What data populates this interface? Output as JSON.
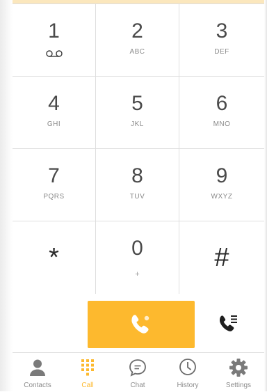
{
  "keypad": {
    "keys": [
      {
        "digit": "1",
        "letters": ""
      },
      {
        "digit": "2",
        "letters": "ABC"
      },
      {
        "digit": "3",
        "letters": "DEF"
      },
      {
        "digit": "4",
        "letters": "GHI"
      },
      {
        "digit": "5",
        "letters": "JKL"
      },
      {
        "digit": "6",
        "letters": "MNO"
      },
      {
        "digit": "7",
        "letters": "PQRS"
      },
      {
        "digit": "8",
        "letters": "TUV"
      },
      {
        "digit": "9",
        "letters": "WXYZ"
      },
      {
        "digit": "*",
        "letters": ""
      },
      {
        "digit": "0",
        "letters": "+"
      },
      {
        "digit": "#",
        "letters": ""
      }
    ]
  },
  "tabs": [
    {
      "label": "Contacts",
      "icon": "person-icon"
    },
    {
      "label": "Call",
      "icon": "dialpad-icon",
      "active": true
    },
    {
      "label": "Chat",
      "icon": "chat-bubble-icon"
    },
    {
      "label": "History",
      "icon": "clock-icon"
    },
    {
      "label": "Settings",
      "icon": "gear-icon"
    }
  ],
  "colors": {
    "accent": "#fdb92e",
    "text": "#4a4a4a",
    "muted": "#8a8a8a",
    "divider": "#dedede"
  }
}
